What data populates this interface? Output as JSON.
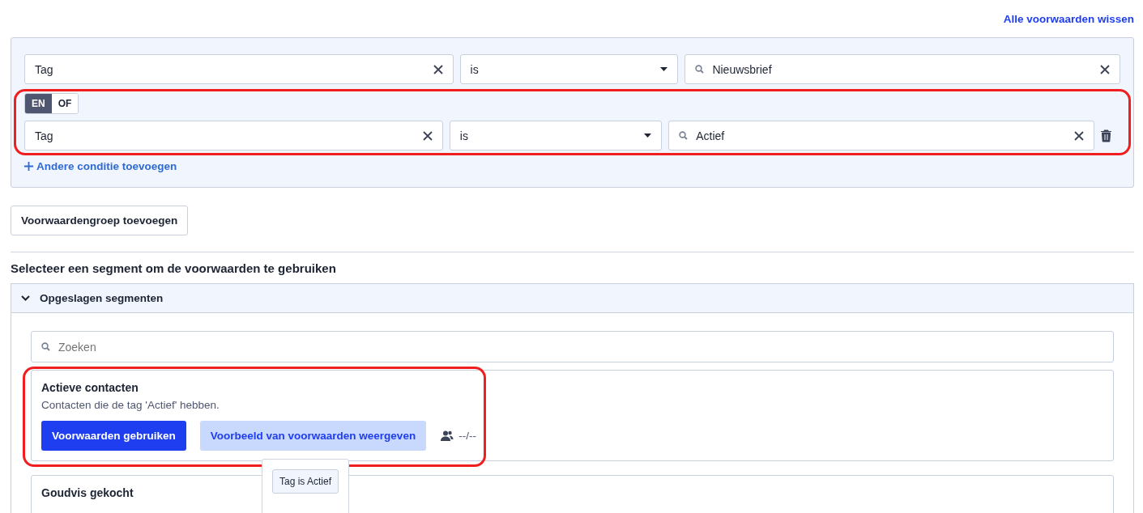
{
  "header": {
    "clear_link": "Alle voorwaarden wissen"
  },
  "condition_group": {
    "conditions": [
      {
        "field": "Tag",
        "operator": "is",
        "value": "Nieuwsbrief",
        "highlighted": false,
        "deletable": false
      },
      {
        "connector": [
          {
            "label": "EN",
            "selected": true
          },
          {
            "label": "OF",
            "selected": false
          }
        ],
        "field": "Tag",
        "operator": "is",
        "value": "Actief",
        "highlighted": true,
        "deletable": true
      }
    ],
    "add_condition": "Andere conditie toevoegen"
  },
  "add_group_button": "Voorwaardengroep toevoegen",
  "segment_heading": "Selecteer een segment om de voorwaarden te gebruiken",
  "saved_segments": {
    "title": "Opgeslagen segmenten",
    "expanded": true,
    "search": {
      "placeholder": "Zoeken"
    },
    "segments": [
      {
        "name": "Actieve contacten",
        "description": "Contacten die de tag 'Actief' hebben.",
        "use_button": "Voorwaarden gebruiken",
        "preview_button": "Voorbeeld van voorwaarden weergeven",
        "count": "--/--",
        "highlighted": true,
        "tooltip": {
          "chips": [
            "Tag is Actief"
          ]
        }
      },
      {
        "name": "Goudvis gekocht",
        "highlighted": false
      }
    ]
  }
}
